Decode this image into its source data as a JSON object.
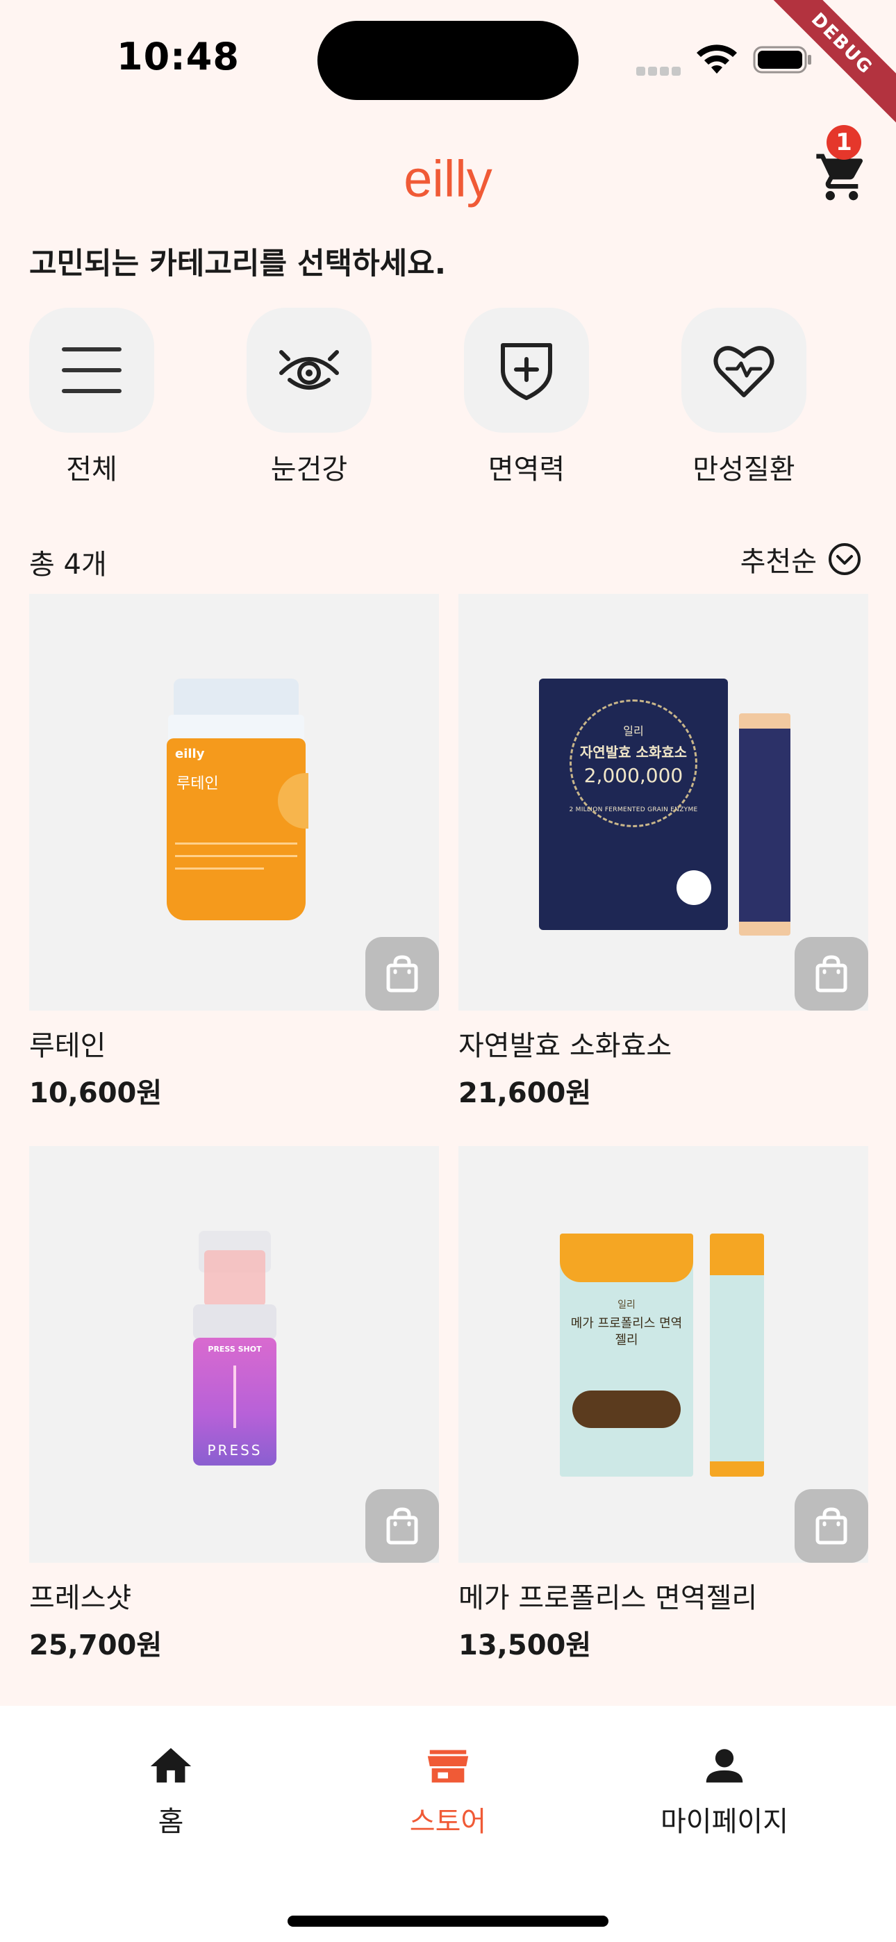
{
  "status_bar": {
    "time": "10:48",
    "debug_label": "DEBUG"
  },
  "header": {
    "title": "eilly",
    "cart_badge": "1"
  },
  "prompt": "고민되는 카테고리를 선택하세요.",
  "categories": [
    {
      "label": "전체",
      "icon": "menu-icon"
    },
    {
      "label": "눈건강",
      "icon": "eye-icon"
    },
    {
      "label": "면역력",
      "icon": "shield-plus-icon"
    },
    {
      "label": "만성질환",
      "icon": "heart-pulse-icon"
    }
  ],
  "list_header": {
    "count": "총 4개",
    "sort_label": "추천순"
  },
  "products": [
    {
      "name": "루테인",
      "price": "10,600원",
      "package_brand": "eilly",
      "package_name": "루테인"
    },
    {
      "name": "자연발효 소화효소",
      "price": "21,600원",
      "package_brand": "일리",
      "package_name": "자연발효 소화효소",
      "package_sub": "2,000,000",
      "package_caption": "2 MILLION FERMENTED GRAIN ENZYME"
    },
    {
      "name": "프레스샷",
      "price": "25,700원",
      "package_name": "PRESS SHOT",
      "package_brand": "PRESS"
    },
    {
      "name": "메가 프로폴리스 면역젤리",
      "price": "13,500원",
      "package_brand": "일리",
      "package_name": "메가 프로폴리스 면역젤리"
    }
  ],
  "bottom_nav": [
    {
      "label": "홈",
      "icon": "home-icon",
      "active": false
    },
    {
      "label": "스토어",
      "icon": "store-icon",
      "active": true
    },
    {
      "label": "마이페이지",
      "icon": "person-icon",
      "active": false
    }
  ],
  "colors": {
    "accent": "#F05A36",
    "background": "#FFF5F2",
    "badge": "#E5372B"
  }
}
